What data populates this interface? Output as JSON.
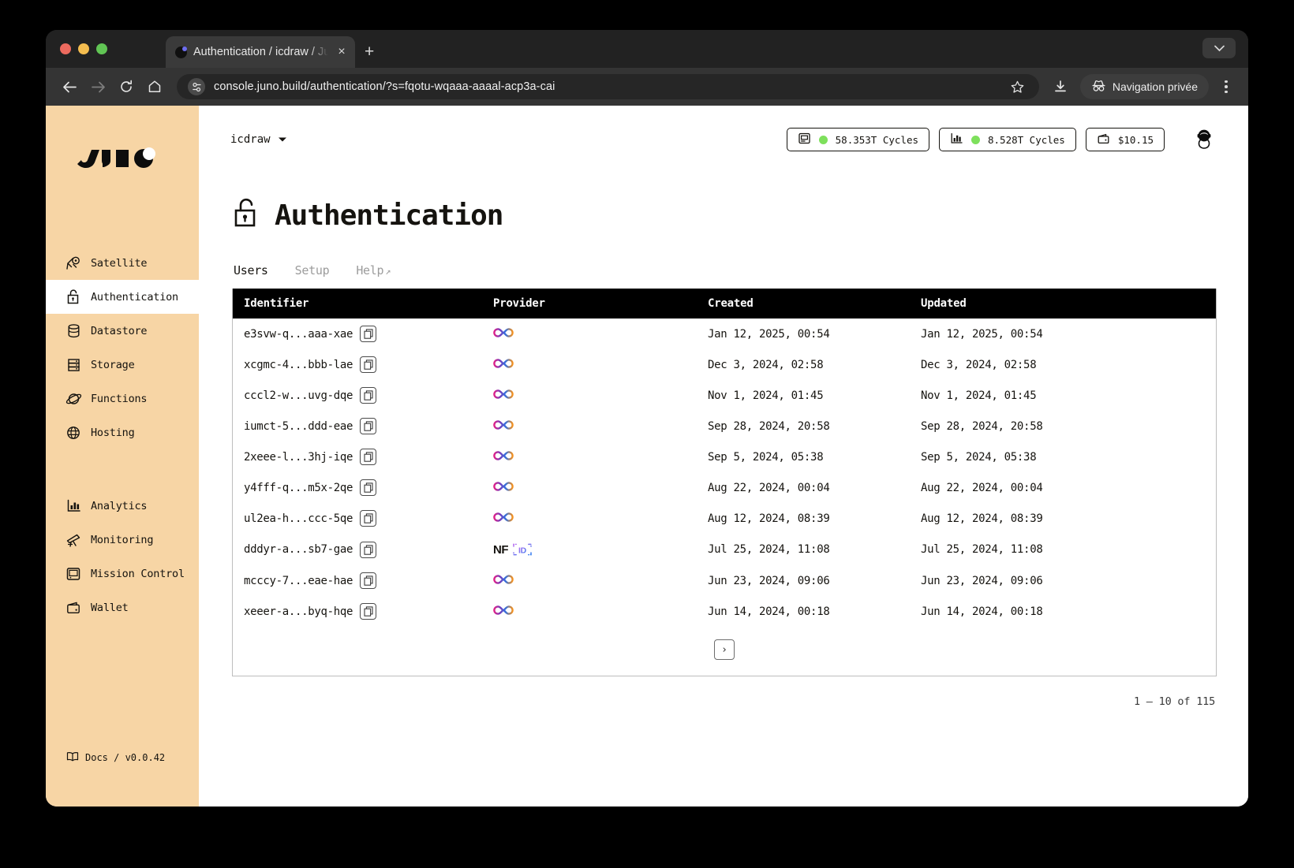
{
  "browser": {
    "tab_title": "Authentication / icdraw / Juno",
    "tab_favicon": "juno-favicon-icon",
    "close_label": "×",
    "new_tab_label": "+",
    "url": "console.juno.build/authentication/?s=fqotu-wqaaa-aaaal-acp3a-cai",
    "private_label": "Navigation privée"
  },
  "sidebar": {
    "logo_alt": "JUNO",
    "groups": [
      {
        "items": [
          {
            "label": "Satellite",
            "icon": "satellite-icon",
            "active": false
          },
          {
            "label": "Authentication",
            "icon": "lock-icon",
            "active": true
          },
          {
            "label": "Datastore",
            "icon": "database-icon",
            "active": false
          },
          {
            "label": "Storage",
            "icon": "storage-icon",
            "active": false
          },
          {
            "label": "Functions",
            "icon": "planet-icon",
            "active": false
          },
          {
            "label": "Hosting",
            "icon": "globe-icon",
            "active": false
          }
        ]
      },
      {
        "items": [
          {
            "label": "Analytics",
            "icon": "bar-chart-icon",
            "active": false
          },
          {
            "label": "Monitoring",
            "icon": "telescope-icon",
            "active": false
          },
          {
            "label": "Mission Control",
            "icon": "monitor-icon",
            "active": false
          },
          {
            "label": "Wallet",
            "icon": "wallet-icon",
            "active": false
          }
        ]
      }
    ],
    "footer": {
      "icon": "book-icon",
      "label": "Docs / v0.0.42"
    }
  },
  "topbar": {
    "satellite_name": "icdraw",
    "satellite_caret": "chevron-down-icon",
    "pills": [
      {
        "icon": "satellite-chip-icon",
        "status": "green",
        "label": "58.353T Cycles"
      },
      {
        "icon": "chart-icon",
        "status": "green",
        "label": "8.528T Cycles"
      },
      {
        "icon": "wallet-icon",
        "status": null,
        "label": "$10.15"
      }
    ],
    "avatar": "astronaut-avatar-icon"
  },
  "page": {
    "icon": "open-lock-icon",
    "title": "Authentication",
    "tabs": [
      {
        "label": "Users",
        "active": true,
        "external": false
      },
      {
        "label": "Setup",
        "active": false,
        "external": false
      },
      {
        "label": "Help",
        "active": false,
        "external": true,
        "ext_glyph": "↗"
      }
    ]
  },
  "table": {
    "columns": [
      "Identifier",
      "Provider",
      "Created",
      "Updated"
    ],
    "copy_icon": "copy-icon",
    "rows": [
      {
        "identifier": "e3svw-q...aaa-xae",
        "provider": "internet-identity",
        "created": "Jan 12, 2025, 00:54",
        "updated": "Jan 12, 2025, 00:54"
      },
      {
        "identifier": "xcgmc-4...bbb-lae",
        "provider": "internet-identity",
        "created": "Dec 3, 2024, 02:58",
        "updated": "Dec 3, 2024, 02:58"
      },
      {
        "identifier": "cccl2-w...uvg-dqe",
        "provider": "internet-identity",
        "created": "Nov 1, 2024, 01:45",
        "updated": "Nov 1, 2024, 01:45"
      },
      {
        "identifier": "iumct-5...ddd-eae",
        "provider": "internet-identity",
        "created": "Sep 28, 2024, 20:58",
        "updated": "Sep 28, 2024, 20:58"
      },
      {
        "identifier": "2xeee-l...3hj-iqe",
        "provider": "internet-identity",
        "created": "Sep 5, 2024, 05:38",
        "updated": "Sep 5, 2024, 05:38"
      },
      {
        "identifier": "y4fff-q...m5x-2qe",
        "provider": "internet-identity",
        "created": "Aug 22, 2024, 00:04",
        "updated": "Aug 22, 2024, 00:04"
      },
      {
        "identifier": "ul2ea-h...ccc-5qe",
        "provider": "internet-identity",
        "created": "Aug 12, 2024, 08:39",
        "updated": "Aug 12, 2024, 08:39"
      },
      {
        "identifier": "dddyr-a...sb7-gae",
        "provider": "nfid",
        "created": "Jul 25, 2024, 11:08",
        "updated": "Jul 25, 2024, 11:08"
      },
      {
        "identifier": "mcccy-7...eae-hae",
        "provider": "internet-identity",
        "created": "Jun 23, 2024, 09:06",
        "updated": "Jun 23, 2024, 09:06"
      },
      {
        "identifier": "xeeer-a...byq-hqe",
        "provider": "internet-identity",
        "created": "Jun 14, 2024, 00:18",
        "updated": "Jun 14, 2024, 00:18"
      }
    ],
    "nfid_label": {
      "nf": "NF",
      "id": "ID"
    },
    "next_page_glyph": "›",
    "count_label": "1 – 10 of 115"
  },
  "colors": {
    "sidebar_bg": "#f7d5a5",
    "accent_green": "#7ee05c",
    "header_bg": "#000000",
    "page_bg": "#ffffff"
  }
}
